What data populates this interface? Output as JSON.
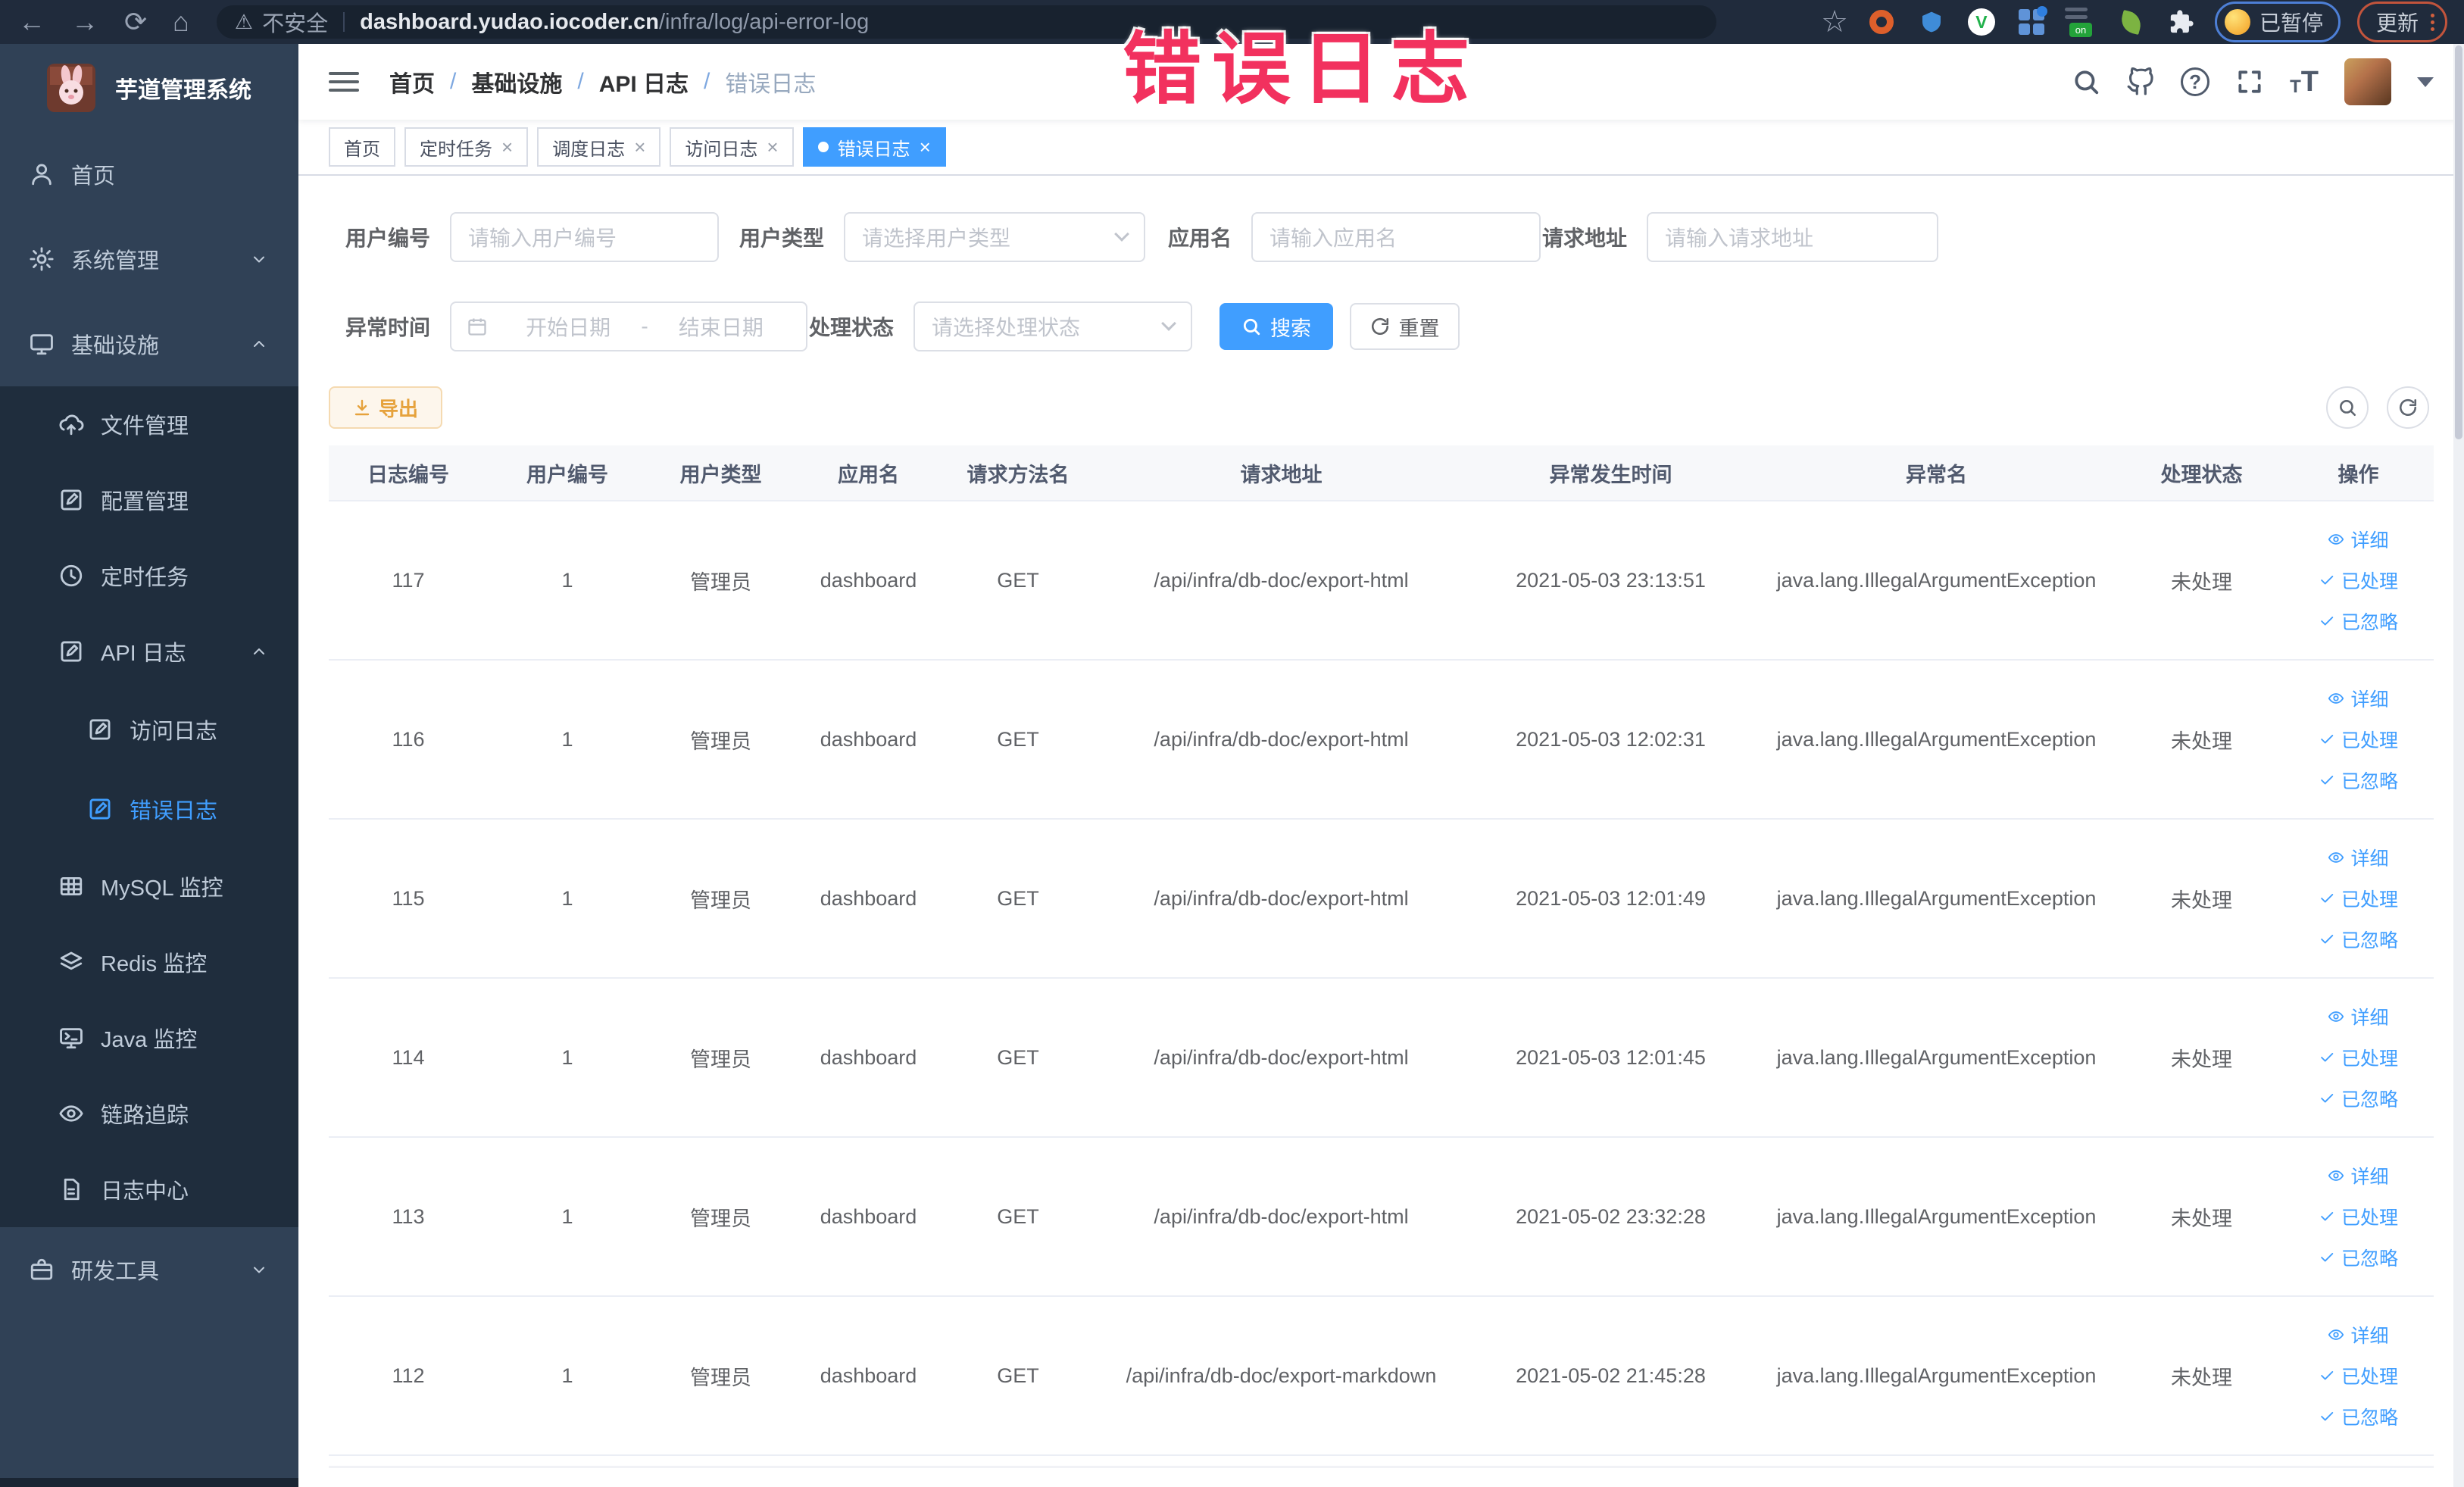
{
  "annotation": {
    "text": "错误日志"
  },
  "browser": {
    "security_label": "不安全",
    "url_domain": "dashboard.yudao.iocoder.cn",
    "url_path": "/infra/log/api-error-log",
    "ext_v_badge": "V",
    "ext_on_badge": "on",
    "paused_badge": "已暂停",
    "update_label": "更新"
  },
  "sidebar": {
    "title": "芋道管理系统",
    "items": [
      {
        "label": "首页",
        "icon": "user",
        "level": 0,
        "chevron": "",
        "active": false
      },
      {
        "label": "系统管理",
        "icon": "gear",
        "level": 0,
        "chevron": "down",
        "active": false
      },
      {
        "label": "基础设施",
        "icon": "monitor",
        "level": 0,
        "chevron": "up",
        "active": false
      },
      {
        "label": "文件管理",
        "icon": "cloud-upload",
        "level": 1,
        "chevron": "",
        "active": false
      },
      {
        "label": "配置管理",
        "icon": "edit",
        "level": 1,
        "chevron": "",
        "active": false
      },
      {
        "label": "定时任务",
        "icon": "clock",
        "level": 1,
        "chevron": "",
        "active": false
      },
      {
        "label": "API 日志",
        "icon": "edit",
        "level": 1,
        "chevron": "up",
        "active": false
      },
      {
        "label": "访问日志",
        "icon": "edit",
        "level": 2,
        "chevron": "",
        "active": false
      },
      {
        "label": "错误日志",
        "icon": "edit",
        "level": 2,
        "chevron": "",
        "active": true
      },
      {
        "label": "MySQL 监控",
        "icon": "table",
        "level": 1,
        "chevron": "",
        "active": false
      },
      {
        "label": "Redis 监控",
        "icon": "layers",
        "level": 1,
        "chevron": "",
        "active": false
      },
      {
        "label": "Java 监控",
        "icon": "java",
        "level": 1,
        "chevron": "",
        "active": false
      },
      {
        "label": "链路追踪",
        "icon": "eye",
        "level": 1,
        "chevron": "",
        "active": false
      },
      {
        "label": "日志中心",
        "icon": "document",
        "level": 1,
        "chevron": "",
        "active": false
      },
      {
        "label": "研发工具",
        "icon": "briefcase",
        "level": 0,
        "chevron": "down",
        "active": false
      }
    ]
  },
  "header": {
    "breadcrumb": [
      "首页",
      "基础设施",
      "API 日志",
      "错误日志"
    ],
    "separator": "/"
  },
  "tabs": [
    {
      "label": "首页",
      "closable": false,
      "active": false
    },
    {
      "label": "定时任务",
      "closable": true,
      "active": false
    },
    {
      "label": "调度日志",
      "closable": true,
      "active": false
    },
    {
      "label": "访问日志",
      "closable": true,
      "active": false
    },
    {
      "label": "错误日志",
      "closable": true,
      "active": true
    }
  ],
  "filters": {
    "user_id": {
      "label": "用户编号",
      "placeholder": "请输入用户编号"
    },
    "user_type": {
      "label": "用户类型",
      "placeholder": "请选择用户类型"
    },
    "app_name": {
      "label": "应用名",
      "placeholder": "请输入应用名"
    },
    "request_url": {
      "label": "请求地址",
      "placeholder": "请输入请求地址"
    },
    "exception_time": {
      "label": "异常时间",
      "start_placeholder": "开始日期",
      "separator": "-",
      "end_placeholder": "结束日期"
    },
    "process_status": {
      "label": "处理状态",
      "placeholder": "请选择处理状态"
    },
    "search_label": "搜索",
    "reset_label": "重置"
  },
  "toolbar": {
    "export_label": "导出"
  },
  "table": {
    "columns": [
      "日志编号",
      "用户编号",
      "用户类型",
      "应用名",
      "请求方法名",
      "请求地址",
      "异常发生时间",
      "异常名",
      "处理状态",
      "操作"
    ],
    "actions": [
      "详细",
      "已处理",
      "已忽略"
    ],
    "rows": [
      {
        "id": "117",
        "user_id": "1",
        "user_type": "管理员",
        "app": "dashboard",
        "method": "GET",
        "url": "/api/infra/db-doc/export-html",
        "time": "2021-05-03 23:13:51",
        "exception": "java.lang.IllegalArgumentException",
        "status": "未处理"
      },
      {
        "id": "116",
        "user_id": "1",
        "user_type": "管理员",
        "app": "dashboard",
        "method": "GET",
        "url": "/api/infra/db-doc/export-html",
        "time": "2021-05-03 12:02:31",
        "exception": "java.lang.IllegalArgumentException",
        "status": "未处理"
      },
      {
        "id": "115",
        "user_id": "1",
        "user_type": "管理员",
        "app": "dashboard",
        "method": "GET",
        "url": "/api/infra/db-doc/export-html",
        "time": "2021-05-03 12:01:49",
        "exception": "java.lang.IllegalArgumentException",
        "status": "未处理"
      },
      {
        "id": "114",
        "user_id": "1",
        "user_type": "管理员",
        "app": "dashboard",
        "method": "GET",
        "url": "/api/infra/db-doc/export-html",
        "time": "2021-05-03 12:01:45",
        "exception": "java.lang.IllegalArgumentException",
        "status": "未处理"
      },
      {
        "id": "113",
        "user_id": "1",
        "user_type": "管理员",
        "app": "dashboard",
        "method": "GET",
        "url": "/api/infra/db-doc/export-html",
        "time": "2021-05-02 23:32:28",
        "exception": "java.lang.IllegalArgumentException",
        "status": "未处理"
      },
      {
        "id": "112",
        "user_id": "1",
        "user_type": "管理员",
        "app": "dashboard",
        "method": "GET",
        "url": "/api/infra/db-doc/export-markdown",
        "time": "2021-05-02 21:45:28",
        "exception": "java.lang.IllegalArgumentException",
        "status": "未处理"
      }
    ]
  },
  "colors": {
    "accent": "#409eff",
    "warning": "#e6a23c",
    "annotation": "#f2315e",
    "sidebar_bg": "#304156",
    "submenu_bg": "#1f2d3d"
  }
}
